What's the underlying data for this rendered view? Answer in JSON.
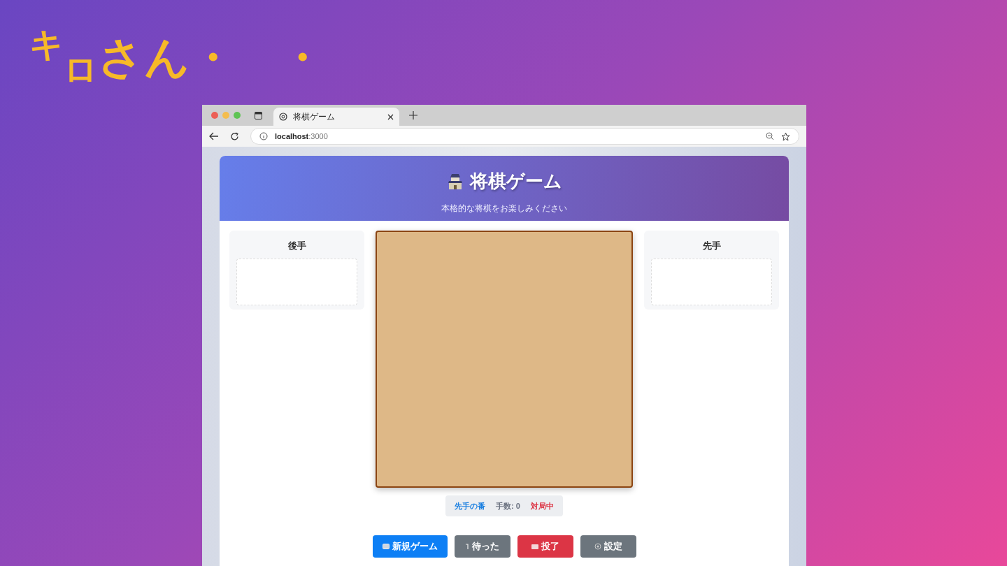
{
  "slide_title": "$^{キ}$$_{ロ}$さん・　・",
  "browser": {
    "tab": {
      "title": "将棋ゲーム",
      "selected": true
    },
    "address": {
      "host": "localhost",
      "port": ":3000"
    }
  },
  "page": {
    "title": "将棋ゲーム",
    "subtitle": "本格的な将棋をお楽しみください",
    "players": [
      {
        "label": "後手"
      },
      {
        "label": "先手"
      }
    ],
    "status": [
      {
        "kind": "turn",
        "text": "先手の番"
      },
      {
        "kind": "moves",
        "text": "手数: 0"
      },
      {
        "kind": "state",
        "text": "対局中"
      }
    ],
    "buttons": [
      {
        "kind": "new",
        "label": "新規ゲーム"
      },
      {
        "kind": "undo",
        "label": "待った"
      },
      {
        "kind": "resign",
        "label": "投了"
      },
      {
        "kind": "settings",
        "label": "設定"
      }
    ]
  }
}
